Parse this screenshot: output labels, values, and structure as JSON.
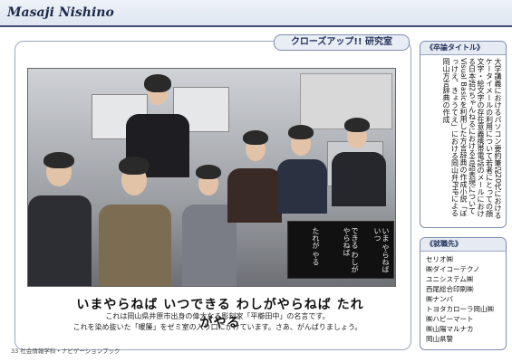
{
  "header": {
    "title": "Masaji Nishino"
  },
  "tag": {
    "label": "クローズアップ!! 研究室"
  },
  "photo": {
    "noren_lines": [
      "いま やらねば いつ",
      "できる わしが やらねば",
      "たれが やる"
    ]
  },
  "motto": "いまやらねば いつできる わしがやらねば たれがやる",
  "caption": {
    "line1": "これは岡山県井原市出身の偉大なる彫刻家「平櫛田中」の名言です。",
    "line2": "これを染め抜いた「暖簾」をゼミ室の入り口にかけています。さあ、がんばりましょう。"
  },
  "thesis": {
    "title": "《卒論タイトル》",
    "body": "大学講義におけるパソコン要約筆記20代におけるケータイメールの利用について若者にとっての顔文字・絵文字の存在意義携帯電話のメールにおける日本語2ちゃんねるにおける言語表現についてVisual Basicを利用した方言辞典の作成小説「ぼっけえ、きょうてえ」における岡山弁PHPによる岡山方言辞典の作成"
  },
  "jobs": {
    "title": "《就職先》",
    "items": [
      "セリオ㈱",
      "㈱ダイコーテクノ",
      "ユニシステム㈱",
      "西尾総合印刷㈱",
      "㈱ナンバ",
      "トヨタカローラ岡山㈱",
      "㈱ハピーマート",
      "㈱山陽マルナカ",
      "岡山県警"
    ]
  },
  "footer": "33  社会情報学科・ナビゲーションブック"
}
